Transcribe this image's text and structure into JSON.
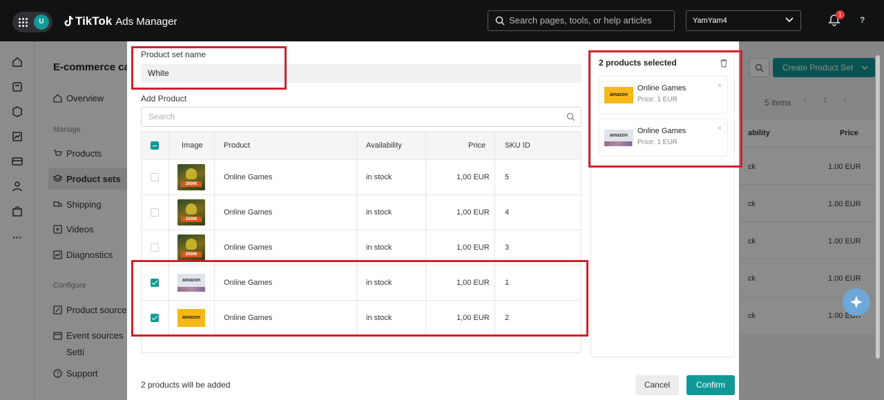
{
  "topbar": {
    "avatar_letter": "U",
    "logo_brand": "TikTok",
    "logo_product": "Ads Manager",
    "search_placeholder": "Search pages, tools, or help articles",
    "account_name": "YamYam4",
    "notification_count": "1",
    "help_label": "?"
  },
  "background_page": {
    "title": "E-commerce ca",
    "nav": {
      "overview": "Overview",
      "manage_section": "Manage",
      "products": "Products",
      "product_sets": "Product sets",
      "shipping": "Shipping",
      "videos": "Videos",
      "diagnostics": "Diagnostics",
      "configure_section": "Configure",
      "product_sources": "Product sources",
      "event_sources": "Event sources",
      "settings_partial": "Setti",
      "support": "Support"
    },
    "create_button": "Create Product Set",
    "items_count": "5 items",
    "pager_page": "1",
    "columns": {
      "availability_partial": "ability",
      "price": "Price"
    },
    "rows": [
      {
        "availability_partial": "ck",
        "price": "1.00 EUR"
      },
      {
        "availability_partial": "ck",
        "price": "1.00 EUR"
      },
      {
        "availability_partial": "ck",
        "price": "1.00 EUR"
      },
      {
        "availability_partial": "ck",
        "price": "1.00 EUR"
      },
      {
        "availability_partial": "ck",
        "price": "1.00 EUR"
      }
    ]
  },
  "modal": {
    "name_label": "Product set name",
    "name_value": "White",
    "add_product_label": "Add Product",
    "search_placeholder": "Search",
    "columns": {
      "image": "Image",
      "product": "Product",
      "availability": "Availability",
      "price": "Price",
      "sku": "SKU ID"
    },
    "rows": [
      {
        "product": "Online Games",
        "availability": "in stock",
        "price": "1,00 EUR",
        "sku": "5",
        "checked": false,
        "thumb": "game",
        "thumb_text": "2500€"
      },
      {
        "product": "Online Games",
        "availability": "in stock",
        "price": "1,00 EUR",
        "sku": "4",
        "checked": false,
        "thumb": "game",
        "thumb_text": "2500€"
      },
      {
        "product": "Online Games",
        "availability": "in stock",
        "price": "1,00 EUR",
        "sku": "3",
        "checked": false,
        "thumb": "game",
        "thumb_text": "2500€"
      },
      {
        "product": "Online Games",
        "availability": "in stock",
        "price": "1,00 EUR",
        "sku": "1",
        "checked": true,
        "thumb": "amazon-grey",
        "thumb_text": "amazon"
      },
      {
        "product": "Online Games",
        "availability": "in stock",
        "price": "1,00 EUR",
        "sku": "2",
        "checked": true,
        "thumb": "amazon-yellow",
        "thumb_text": "amazon"
      }
    ],
    "selected": {
      "title": "2 products selected",
      "items": [
        {
          "name": "Online Games",
          "price": "Price: 1 EUR",
          "thumb": "amazon-yellow",
          "thumb_text": "amazon",
          "remove": "×"
        },
        {
          "name": "Online Games",
          "price": "Price: 1 EUR",
          "thumb": "amazon-grey",
          "thumb_text": "amazon",
          "remove": "×"
        }
      ]
    },
    "footer_text": "2 products will be added",
    "cancel_label": "Cancel",
    "confirm_label": "Confirm"
  },
  "colors": {
    "accent": "#129997",
    "highlight": "#d0202a",
    "topbar": "#111214"
  }
}
